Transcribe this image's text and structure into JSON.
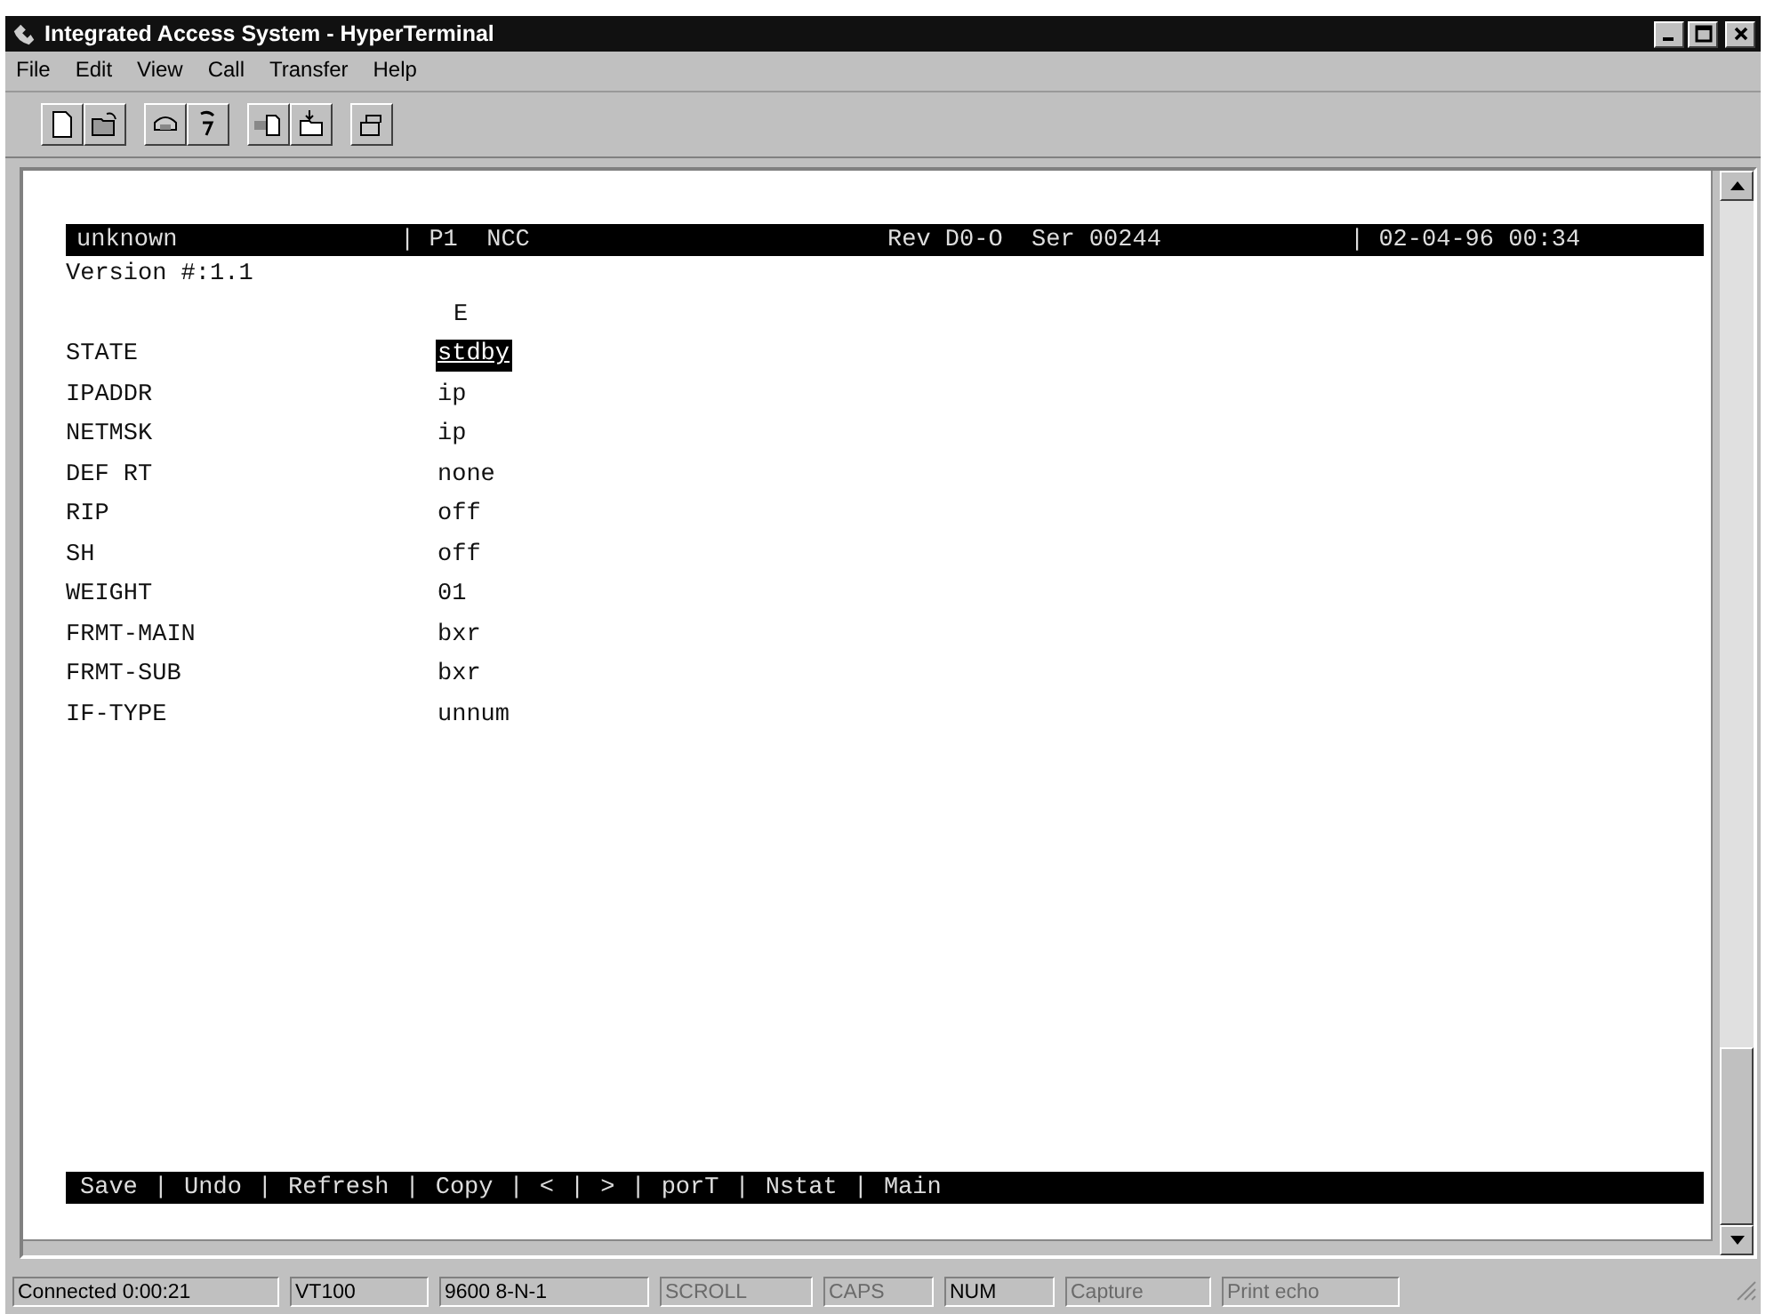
{
  "window": {
    "title": "Integrated Access System - HyperTerminal"
  },
  "menu": [
    "File",
    "Edit",
    "View",
    "Call",
    "Transfer",
    "Help"
  ],
  "toolbar": [
    {
      "kind": "new"
    },
    {
      "kind": "open"
    },
    {
      "kind": "connect"
    },
    {
      "kind": "disconnect"
    },
    {
      "kind": "send"
    },
    {
      "kind": "receive"
    },
    {
      "kind": "properties"
    }
  ],
  "terminal": {
    "header": [
      "unknown",
      "| P1  NCC",
      "Rev D0-O  Ser 00244",
      "| 02-04-96 00:34"
    ],
    "version": "Version #:1.1",
    "column_heading": "E",
    "fields": [
      {
        "label": "STATE",
        "value": "stdby",
        "selected": true
      },
      {
        "label": "IPADDR",
        "value": "ip",
        "selected": false
      },
      {
        "label": "NETMSK",
        "value": "ip",
        "selected": false
      },
      {
        "label": "DEF RT",
        "value": "none",
        "selected": false
      },
      {
        "label": "RIP",
        "value": "off",
        "selected": false
      },
      {
        "label": "SH",
        "value": "off",
        "selected": false
      },
      {
        "label": "WEIGHT",
        "value": "01",
        "selected": false
      },
      {
        "label": "FRMT-MAIN",
        "value": "bxr",
        "selected": false
      },
      {
        "label": "FRMT-SUB",
        "value": "bxr",
        "selected": false
      },
      {
        "label": "IF-TYPE",
        "value": "unnum",
        "selected": false
      }
    ],
    "commands": [
      "Save",
      "Undo",
      "Refresh",
      "Copy",
      "<",
      ">",
      "porT",
      "Nstat",
      "Main"
    ],
    "separator": "|"
  },
  "status_bar": [
    {
      "text": "Connected 0:00:21",
      "disabled": false
    },
    {
      "text": "VT100",
      "disabled": false
    },
    {
      "text": "9600 8-N-1",
      "disabled": false
    },
    {
      "text": "SCROLL",
      "disabled": true
    },
    {
      "text": "CAPS",
      "disabled": true
    },
    {
      "text": "NUM",
      "disabled": false
    },
    {
      "text": "Capture",
      "disabled": true
    },
    {
      "text": "Print echo",
      "disabled": true
    }
  ]
}
